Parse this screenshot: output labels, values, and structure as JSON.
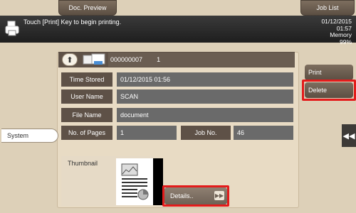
{
  "tabs": {
    "doc_preview": "Doc. Preview",
    "job_list": "Job List"
  },
  "message": "Touch [Print] Key to begin printing.",
  "status": {
    "date": "01/12/2015",
    "time": "01:57",
    "memory_label": "Memory",
    "memory_value": "99%"
  },
  "header": {
    "id": "000000007",
    "count": "1"
  },
  "fields": {
    "time_stored_label": "Time Stored",
    "time_stored": "01/12/2015 01:56",
    "user_name_label": "User Name",
    "user_name": "SCAN",
    "file_name_label": "File Name",
    "file_name": "document",
    "pages_label": "No. of Pages",
    "pages": "1",
    "job_no_label": "Job No.",
    "job_no": "46"
  },
  "thumbnail_label": "Thumbnail",
  "details_label": "Details..",
  "actions": {
    "print": "Print",
    "delete": "Delete"
  },
  "system_label": "System",
  "icons": [
    "printer-icon",
    "up-arrow-icon",
    "folder-icon",
    "right-arrow-icon",
    "double-left-arrow-icon"
  ],
  "colors": {
    "highlight": "#e31b1b"
  }
}
